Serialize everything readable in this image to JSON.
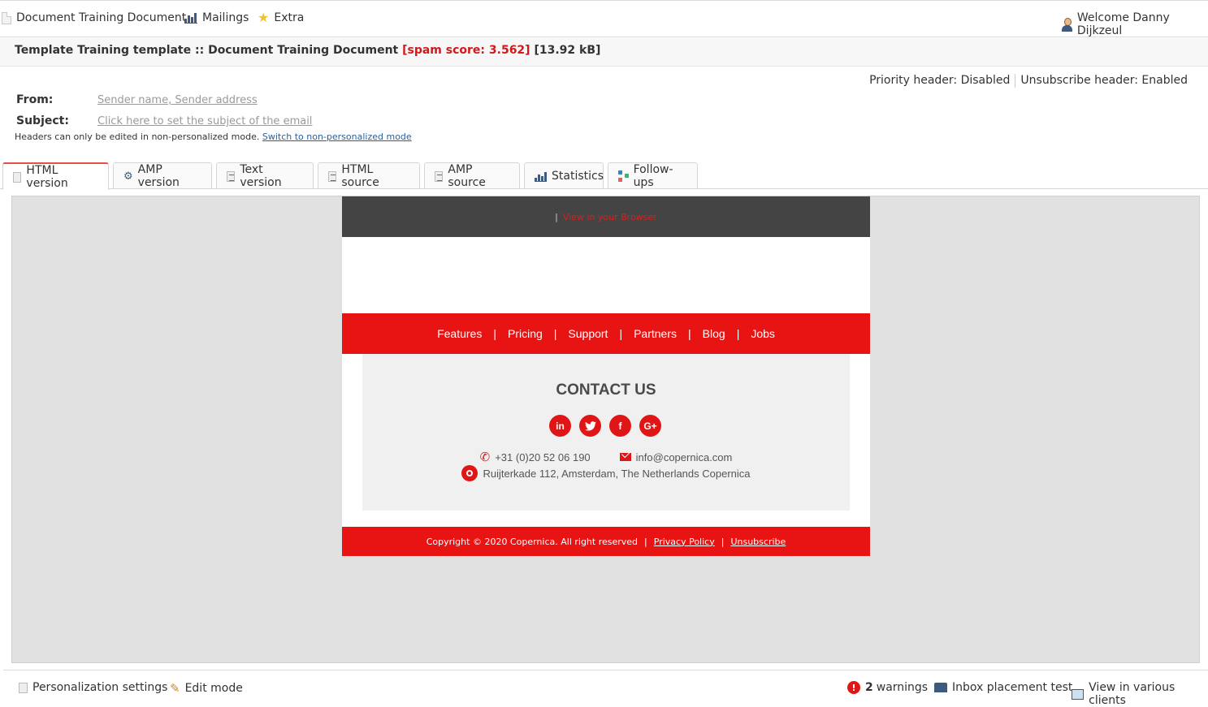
{
  "topbar": {
    "menu": [
      {
        "label": "Document Training Document",
        "icon": "document-icon"
      },
      {
        "label": "Mailings",
        "icon": "chart-icon"
      },
      {
        "label": "Extra",
        "icon": "star-icon"
      }
    ],
    "welcome": "Welcome Danny Dijkzeul"
  },
  "title": {
    "main": "Template Training template :: Document Training Document",
    "spam": "[spam score: 3.562]",
    "size": "[13.92 kB]"
  },
  "headers": {
    "priority": "Priority header: Disabled",
    "unsubscribe": "Unsubscribe header: Enabled"
  },
  "fields": {
    "from_label": "From:",
    "from_value": "Sender name, Sender address",
    "subject_label": "Subject:",
    "subject_value": "Click here to set the subject of the email",
    "note": "Headers can only be edited in non-personalized mode.",
    "note_link": "Switch to non-personalized mode"
  },
  "tabs": [
    {
      "label": "HTML version",
      "active": true
    },
    {
      "label": "AMP version"
    },
    {
      "label": "Text version"
    },
    {
      "label": "HTML source"
    },
    {
      "label": "AMP source"
    },
    {
      "label": "Statistics"
    },
    {
      "label": "Follow-ups"
    }
  ],
  "email": {
    "top_bar": "|",
    "view_browser": "View in your Browser",
    "nav": [
      "Features",
      "Pricing",
      "Support",
      "Partners",
      "Blog",
      "Jobs"
    ],
    "nav_sep": "|",
    "contact_title": "CONTACT US",
    "socials": [
      "in",
      "t",
      "f",
      "G+"
    ],
    "phone": "+31 (0)20 52 06 190",
    "email": "info@copernica.com",
    "address": "Ruijterkade 112, Amsterdam, The Netherlands Copernica",
    "footer": {
      "copyright": "Copyright © 2020 Copernica. All right reserved",
      "sep": "|",
      "privacy": "Privacy Policy",
      "unsubscribe": "Unsubscribe"
    }
  },
  "bottombar": {
    "personalization": "Personalization settings",
    "edit_mode": "Edit mode",
    "warnings_count": "2",
    "warnings_label": "warnings",
    "inbox_test": "Inbox placement test",
    "view_clients": "View in various clients"
  },
  "colors": {
    "brand_red": "#e81313",
    "dark_bar": "#444444",
    "spam_red": "#d0191b"
  }
}
